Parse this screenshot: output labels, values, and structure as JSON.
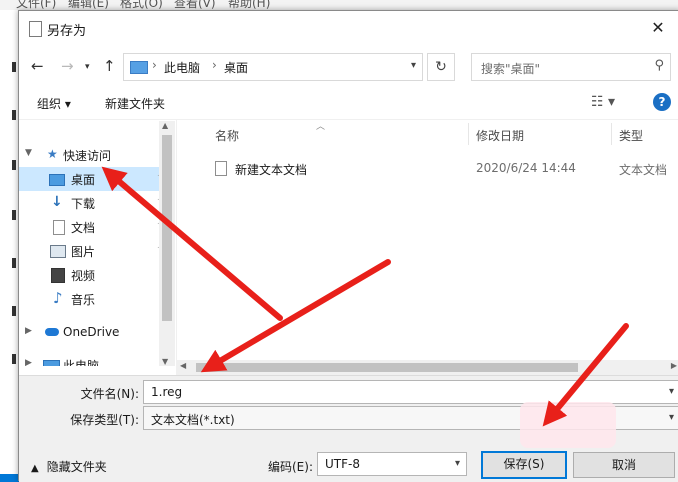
{
  "menubar": [
    "文件(F)",
    "编辑(E)",
    "格式(O)",
    "查看(V)",
    "帮助(H)"
  ],
  "dialog": {
    "title": "另存为",
    "close": "✕"
  },
  "address": {
    "crumbs": [
      "此电脑",
      "桌面"
    ],
    "separator": "›",
    "search_placeholder": "搜索\"桌面\""
  },
  "toolbar": {
    "organize": "组织 ▾",
    "new_folder": "新建文件夹",
    "help": "?"
  },
  "nav": {
    "quick_access": "快速访问",
    "desktop": "桌面",
    "downloads": "下载",
    "documents": "文档",
    "pictures": "图片",
    "videos": "视频",
    "music": "音乐",
    "onedrive": "OneDrive",
    "this_pc": "此电脑"
  },
  "columns": {
    "name": "名称",
    "modified": "修改日期",
    "type": "类型"
  },
  "files": [
    {
      "name": "新建文本文档",
      "modified": "2020/6/24 14:44",
      "type": "文本文档"
    }
  ],
  "form": {
    "filename_label": "文件名(N):",
    "filename_value": "1.reg",
    "filetype_label": "保存类型(T):",
    "filetype_value": "文本文档(*.txt)",
    "encoding_label": "编码(E):",
    "encoding_value": "UTF-8",
    "hide_folders": "隐藏文件夹",
    "save": "保存(S)",
    "cancel": "取消"
  },
  "colors": {
    "selection": "#cce8ff",
    "arrow": "#e8201a",
    "accent": "#0078d7"
  }
}
